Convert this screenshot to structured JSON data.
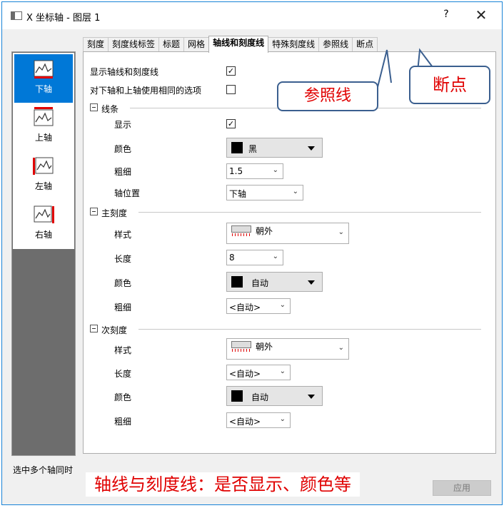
{
  "window": {
    "title": "X 坐标轴 - 图层 1",
    "help": "?",
    "close": "✕"
  },
  "tabs": [
    "刻度",
    "刻度线标签",
    "标题",
    "网格",
    "轴线和刻度线",
    "特殊刻度线",
    "参照线",
    "断点"
  ],
  "active_tab": "轴线和刻度线",
  "axis_list": [
    {
      "label": "下轴",
      "selected": true,
      "icon": "bottom-axis-icon"
    },
    {
      "label": "上轴",
      "selected": false,
      "icon": "top-axis-icon"
    },
    {
      "label": "左轴",
      "selected": false,
      "icon": "left-axis-icon"
    },
    {
      "label": "右轴",
      "selected": false,
      "icon": "right-axis-icon"
    }
  ],
  "options": {
    "show_axes_ticks": "显示轴线和刻度线",
    "same_options": "对下轴和上轴使用相同的选项"
  },
  "line_section": {
    "title": "线条",
    "show_label": "显示",
    "color_label": "颜色",
    "color_value": "黑",
    "thickness_label": "粗细",
    "thickness_value": "1.5",
    "position_label": "轴位置",
    "position_value": "下轴"
  },
  "major_section": {
    "title": "主刻度",
    "style_label": "样式",
    "style_value": "朝外",
    "length_label": "长度",
    "length_value": "8",
    "color_label": "颜色",
    "color_value": "自动",
    "thickness_label": "粗细",
    "thickness_value": "<自动>"
  },
  "minor_section": {
    "title": "次刻度",
    "style_label": "样式",
    "style_value": "朝外",
    "length_label": "长度",
    "length_value": "<自动>",
    "color_label": "颜色",
    "color_value": "自动",
    "thickness_label": "粗细",
    "thickness_value": "<自动>"
  },
  "callouts": {
    "reference": "参照线",
    "breaks": "断点"
  },
  "bottom": {
    "hint": "选中多个轴同时",
    "note": "轴线与刻度线：是否显示、颜色等",
    "apply": "应用"
  },
  "colors": {
    "accent": "#0078d7",
    "annotation": "#e00000",
    "callout_border": "#3b5f8f"
  }
}
